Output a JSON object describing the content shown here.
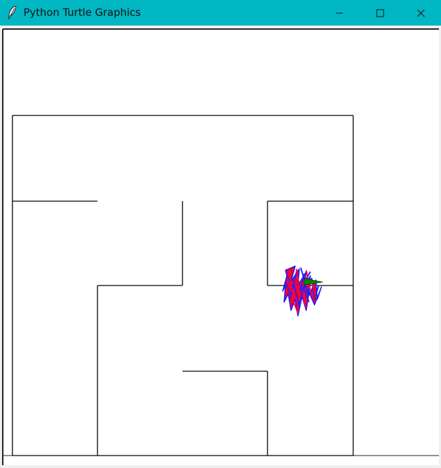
{
  "window": {
    "title": "Python Turtle Graphics",
    "titlebar_color": "#00b7c3",
    "canvas_background": "#ffffff"
  },
  "titlebar_buttons": [
    {
      "name": "minimize",
      "icon": "minimize-icon"
    },
    {
      "name": "maximize",
      "icon": "maximize-icon"
    },
    {
      "name": "close",
      "icon": "close-icon"
    }
  ],
  "app_icon": "feather-icon",
  "maze": {
    "wall_color": "#000000",
    "description_segments": 14
  },
  "turtle": {
    "trail_colors": [
      "#ff0000",
      "#0000ff"
    ],
    "head_color": "#008000"
  }
}
